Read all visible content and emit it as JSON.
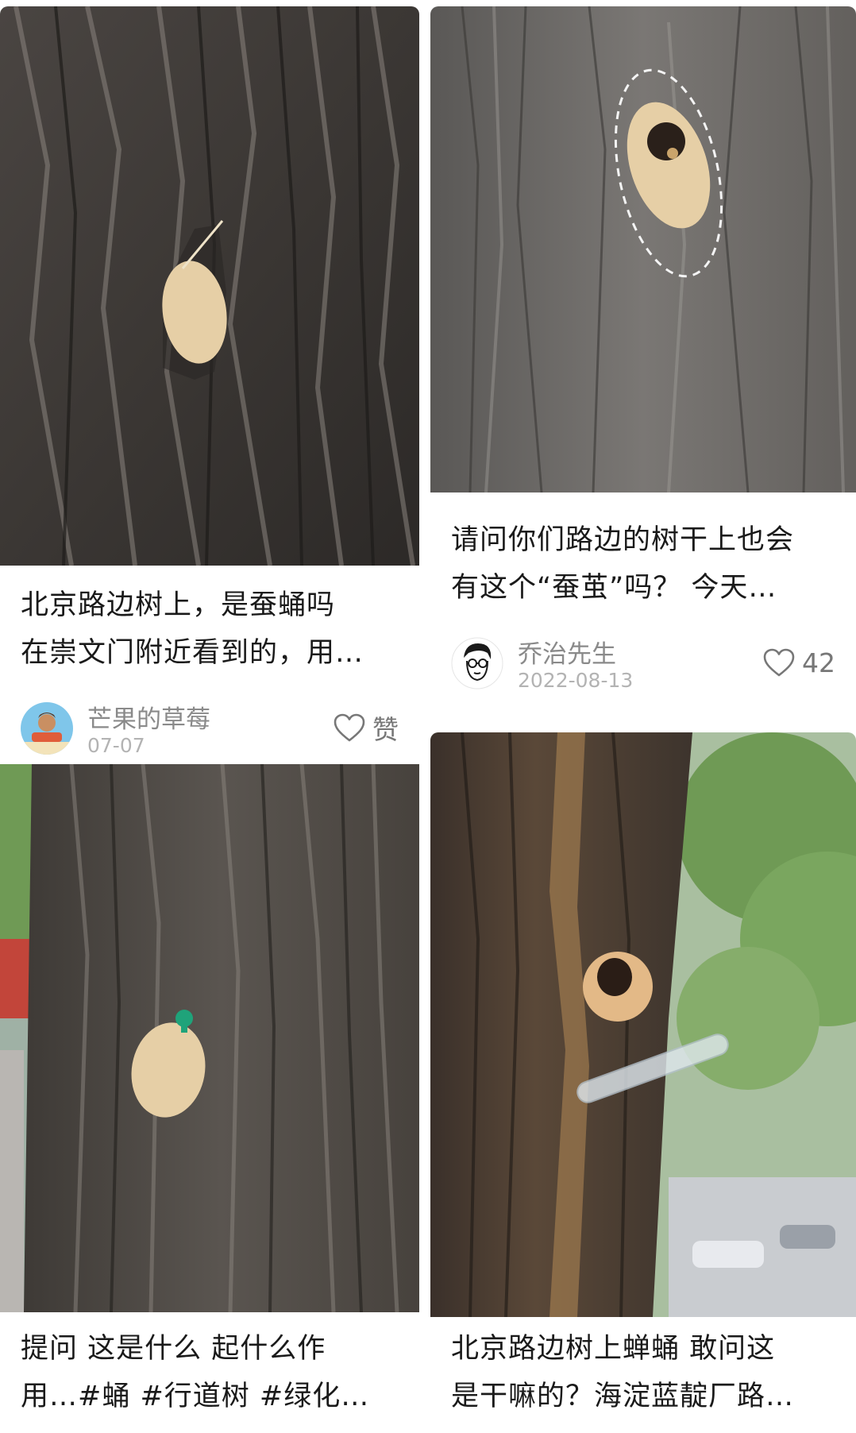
{
  "feed": {
    "cards": [
      {
        "title": "北京路边树上，是蚕蛹吗\n在崇文门附近看到的，用…",
        "author": "芒果的草莓",
        "date": "07-07",
        "like_label": "赞"
      },
      {
        "title": "请问你们路边的树干上也会\n有这个“蚕茧”吗？ 今天…",
        "author": "乔治先生",
        "date": "2022-08-13",
        "like_label": "42"
      },
      {
        "title": "提问 这是什么 起什么作\n用…#蛹 #行道树 #绿化…"
      },
      {
        "title": "北京路边树上蝉蛹 敢问这\n是干嘛的？海淀蓝靛厂路…"
      }
    ]
  },
  "colors": {
    "bark_dark": "#3a3633",
    "bark_light": "#7d7873",
    "cocoon": "#e6cfa6",
    "pin": "#1fa37a",
    "foliage": "#6f9a55"
  }
}
